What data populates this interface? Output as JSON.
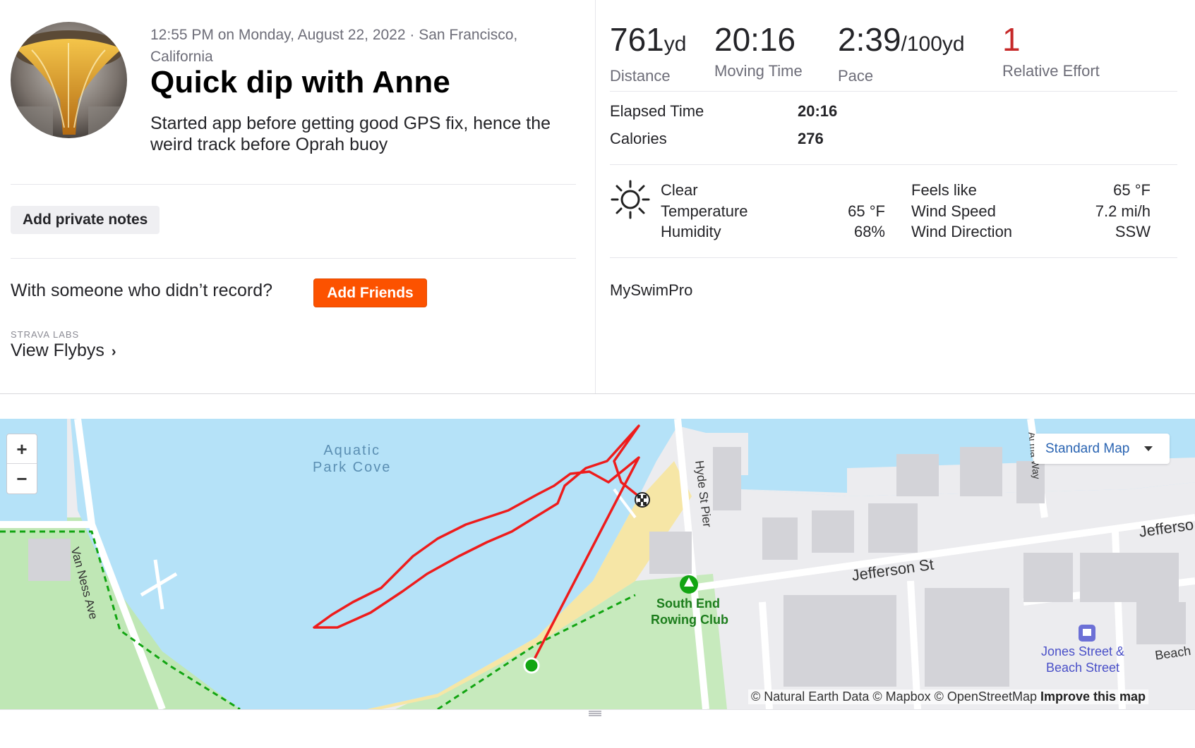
{
  "activity": {
    "meta_line": "12:55 PM on Monday, August 22, 2022 · San Francisco, California",
    "title": "Quick dip with Anne",
    "description": "Started app before getting good GPS fix, hence the weird track before Oprah buoy",
    "add_notes_label": "Add private notes",
    "with_someone_text": "With someone who didn’t record?",
    "add_friends_label": "Add Friends",
    "labs_label": "STRAVA LABS",
    "flybys_label": "View Flybys"
  },
  "stats": {
    "distance": {
      "value": "761",
      "unit": "yd",
      "label": "Distance"
    },
    "moving_time": {
      "value": "20:16",
      "label": "Moving Time"
    },
    "pace": {
      "value": "2:39",
      "unit": "/100yd",
      "label": "Pace"
    },
    "relative_effort": {
      "value": "1",
      "label": "Relative Effort"
    }
  },
  "more_stats": {
    "elapsed_label": "Elapsed Time",
    "elapsed_value": "20:16",
    "calories_label": "Calories",
    "calories_value": "276"
  },
  "weather": {
    "icon": "sun-icon",
    "condition": "Clear",
    "temperature_label": "Temperature",
    "temperature_value": "65 °F",
    "humidity_label": "Humidity",
    "humidity_value": "68%",
    "feels_like_label": "Feels like",
    "feels_like_value": "65 °F",
    "wind_speed_label": "Wind Speed",
    "wind_speed_value": "7.2 mi/h",
    "wind_direction_label": "Wind Direction",
    "wind_direction_value": "SSW"
  },
  "device": "MySwimPro",
  "map": {
    "zoom_in": "+",
    "zoom_out": "−",
    "style_label": "Standard Map",
    "labels": {
      "cove": "Aquatic\nPark Cove",
      "van_ness": "Van Ness Ave",
      "hyde_pier": "Hyde St Pier",
      "jefferson": "Jefferson St",
      "jefferson_east": "Jefferso",
      "rowing_club_1": "South End",
      "rowing_club_2": "Rowing Club",
      "jones_1": "Jones Street &",
      "jones_2": "Beach Street",
      "beach": "Beach",
      "way": "Al    ma Way"
    },
    "attribution": "© Natural Earth Data © Mapbox © OpenStreetMap",
    "improve": "Improve this map",
    "colors": {
      "water": "#b5e2f8",
      "park": "#bfe7b5",
      "route": "#ee1c1c",
      "start": "#12a512"
    }
  }
}
